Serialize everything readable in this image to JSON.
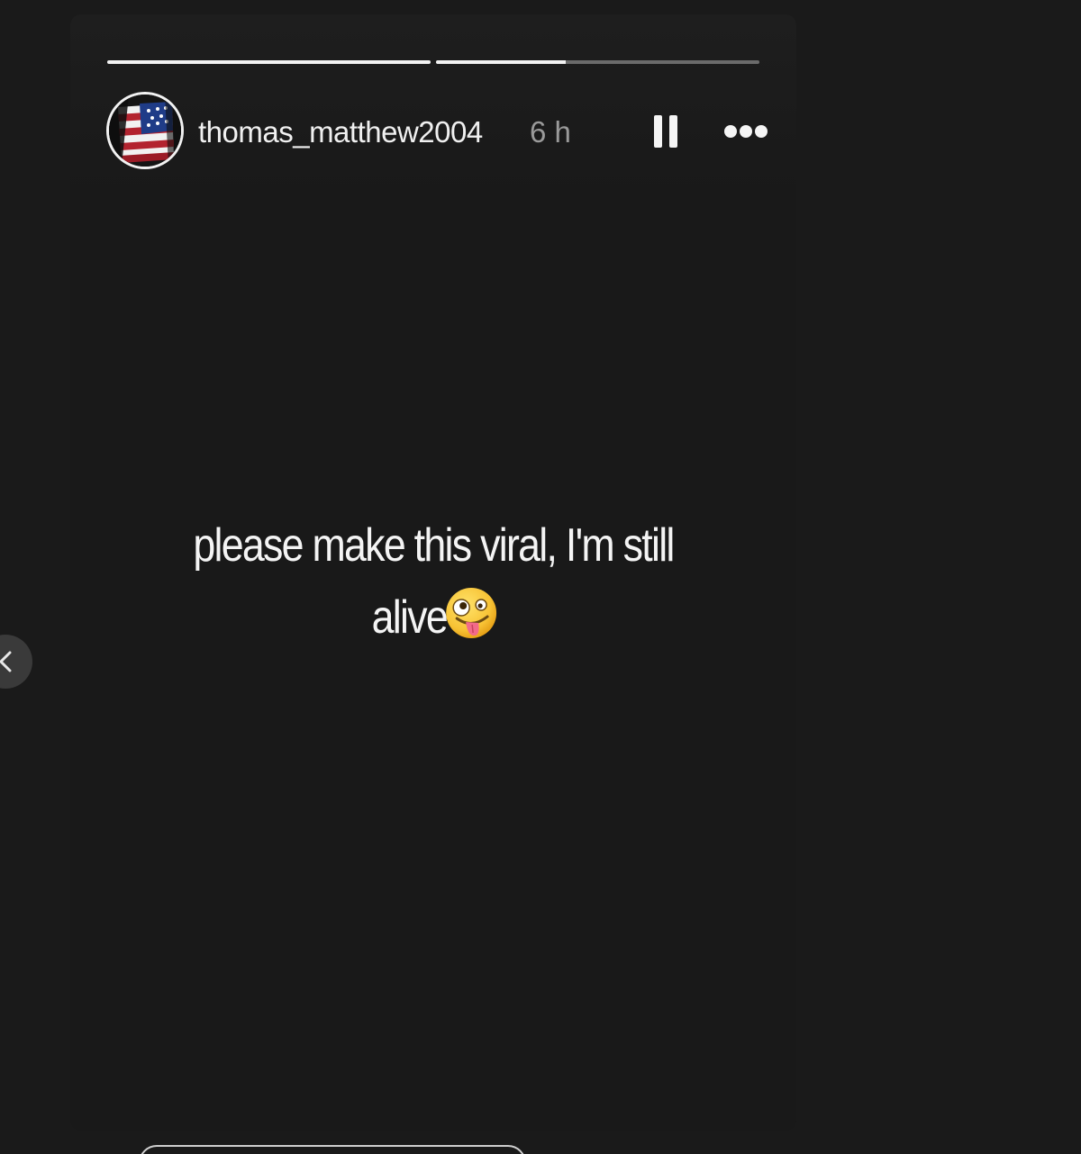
{
  "story": {
    "user": {
      "username": "thomas_matthew2004",
      "time_ago": "6 h"
    },
    "progress": {
      "segments": [
        1.0,
        0.4
      ]
    },
    "caption": {
      "line1": "please make this viral, I'm still",
      "line2": "alive"
    },
    "controls": {
      "pause_icon": "pause-icon",
      "more_icon": "more-options-icon",
      "prev_icon": "chevron-left-icon"
    }
  },
  "colors": {
    "background": "#1a1a1a",
    "story_background": "#191919",
    "text": "#f0f0f0",
    "muted_text": "#9a9a9a"
  }
}
